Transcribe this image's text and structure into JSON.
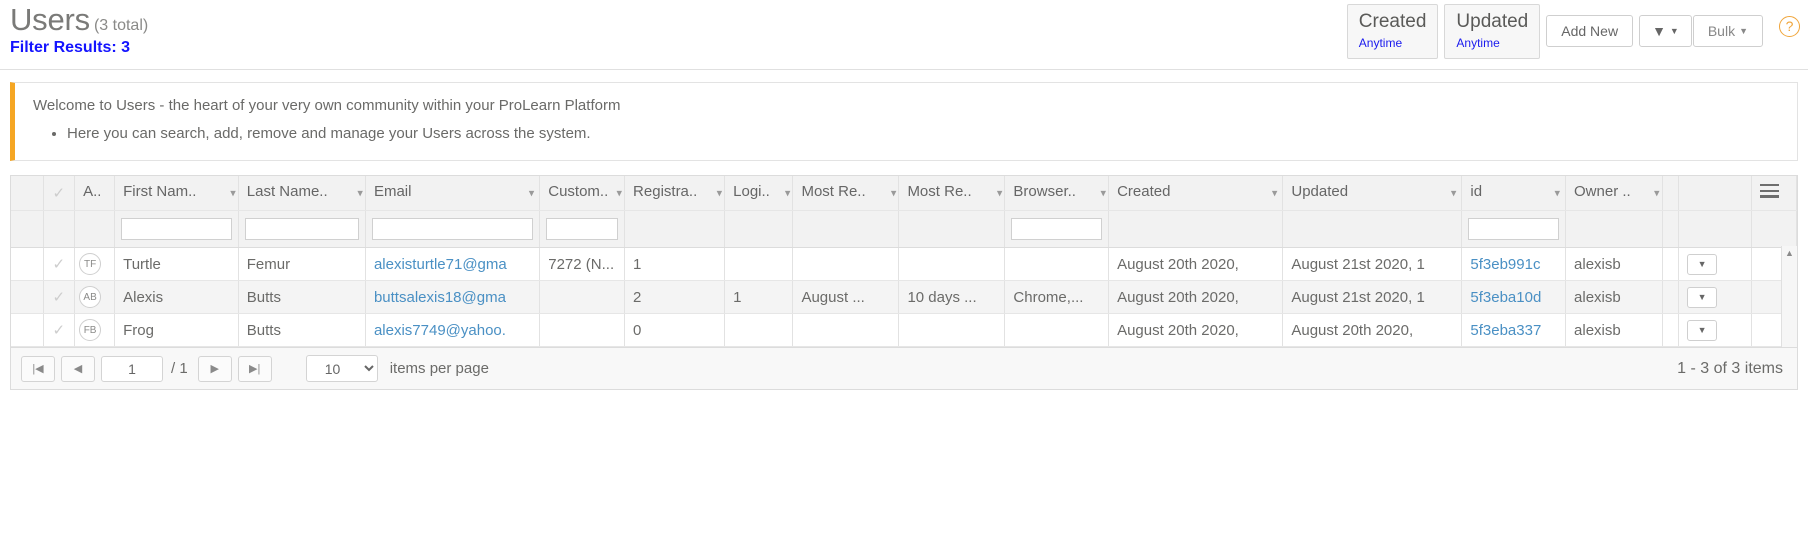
{
  "header": {
    "title": "Users",
    "count_label": "(3 total)",
    "filter_results": "Filter Results: 3",
    "created_card": {
      "title": "Created",
      "value": "Anytime"
    },
    "updated_card": {
      "title": "Updated",
      "value": "Anytime"
    },
    "add_new_label": "Add New",
    "filter_icon": "funnel-icon",
    "bulk_label": "Bulk",
    "help_icon": "?",
    "accent_orange": "#f5a623",
    "link_blue": "#1a1aee"
  },
  "banner": {
    "lead": "Welcome to Users - the heart of your very own community within your ProLearn Platform",
    "bullets": [
      "Here you can search, add, remove and manage your Users across the system."
    ]
  },
  "grid": {
    "columns": [
      {
        "label": "",
        "key": "sel",
        "truncated": false,
        "chevron": false,
        "filter": false
      },
      {
        "label": "",
        "key": "chk",
        "truncated": false,
        "chevron": false,
        "filter": false
      },
      {
        "label": "A...",
        "key": "avatar",
        "truncated": true,
        "chevron": false,
        "filter": false
      },
      {
        "label": "First Nam..",
        "key": "first_name",
        "truncated": true,
        "chevron": true,
        "filter": true
      },
      {
        "label": "Last Name..",
        "key": "last_name",
        "truncated": true,
        "chevron": true,
        "filter": true
      },
      {
        "label": "Email",
        "key": "email",
        "truncated": false,
        "chevron": true,
        "filter": true
      },
      {
        "label": "Custom..",
        "key": "custom",
        "truncated": true,
        "chevron": true,
        "filter": true
      },
      {
        "label": "Registra..",
        "key": "registrations",
        "truncated": true,
        "chevron": true,
        "filter": false
      },
      {
        "label": "Logi..",
        "key": "logins",
        "truncated": true,
        "chevron": true,
        "filter": false
      },
      {
        "label": "Most Re..",
        "key": "most_recent_1",
        "truncated": true,
        "chevron": true,
        "filter": false
      },
      {
        "label": "Most Re..",
        "key": "most_recent_2",
        "truncated": true,
        "chevron": true,
        "filter": false
      },
      {
        "label": "Browser..",
        "key": "browser",
        "truncated": true,
        "chevron": true,
        "filter": true
      },
      {
        "label": "Created",
        "key": "created",
        "truncated": false,
        "chevron": true,
        "filter": false
      },
      {
        "label": "Updated",
        "key": "updated",
        "truncated": false,
        "chevron": true,
        "filter": false
      },
      {
        "label": "id",
        "key": "id",
        "truncated": false,
        "chevron": true,
        "filter": true
      },
      {
        "label": "Owner ..",
        "key": "owner",
        "truncated": true,
        "chevron": true,
        "filter": false
      },
      {
        "label": "",
        "key": "spacer",
        "truncated": false,
        "chevron": false,
        "filter": false
      },
      {
        "label": "",
        "key": "actions",
        "truncated": false,
        "chevron": false,
        "filter": false
      },
      {
        "label": "menu-icon",
        "key": "menu",
        "truncated": false,
        "chevron": false,
        "filter": false
      }
    ],
    "rows": [
      {
        "initials": "TF",
        "first_name": "Turtle",
        "last_name": "Femur",
        "email": "alexisturtle71@gma",
        "custom": "7272 (N...",
        "registrations": "1",
        "logins": "",
        "most_recent_1": "",
        "most_recent_2": "",
        "browser": "",
        "created": "August 20th 2020,",
        "updated": "August 21st 2020, 1",
        "id": "5f3eb991c",
        "owner": "alexisb"
      },
      {
        "initials": "AB",
        "first_name": "Alexis",
        "last_name": "Butts",
        "email": "buttsalexis18@gma",
        "custom": "",
        "registrations": "2",
        "logins": "1",
        "most_recent_1": "August ...",
        "most_recent_2": "10 days ...",
        "browser": "Chrome,...",
        "created": "August 20th 2020,",
        "updated": "August 21st 2020, 1",
        "id": "5f3eba10d",
        "owner": "alexisb"
      },
      {
        "initials": "FB",
        "first_name": "Frog",
        "last_name": "Butts",
        "email": "alexis7749@yahoo.",
        "custom": "",
        "registrations": "0",
        "logins": "",
        "most_recent_1": "",
        "most_recent_2": "",
        "browser": "",
        "created": "August 20th 2020,",
        "updated": "August 20th 2020,",
        "id": "5f3eba337",
        "owner": "alexisb"
      }
    ]
  },
  "pager": {
    "first_label": "|◀",
    "prev_label": "◀",
    "page_value": "1",
    "of_label": "/ 1",
    "next_label": "▶",
    "last_label": "▶|",
    "page_size": "10",
    "items_per_page_label": "items per page",
    "summary": "1 - 3 of 3 items"
  }
}
